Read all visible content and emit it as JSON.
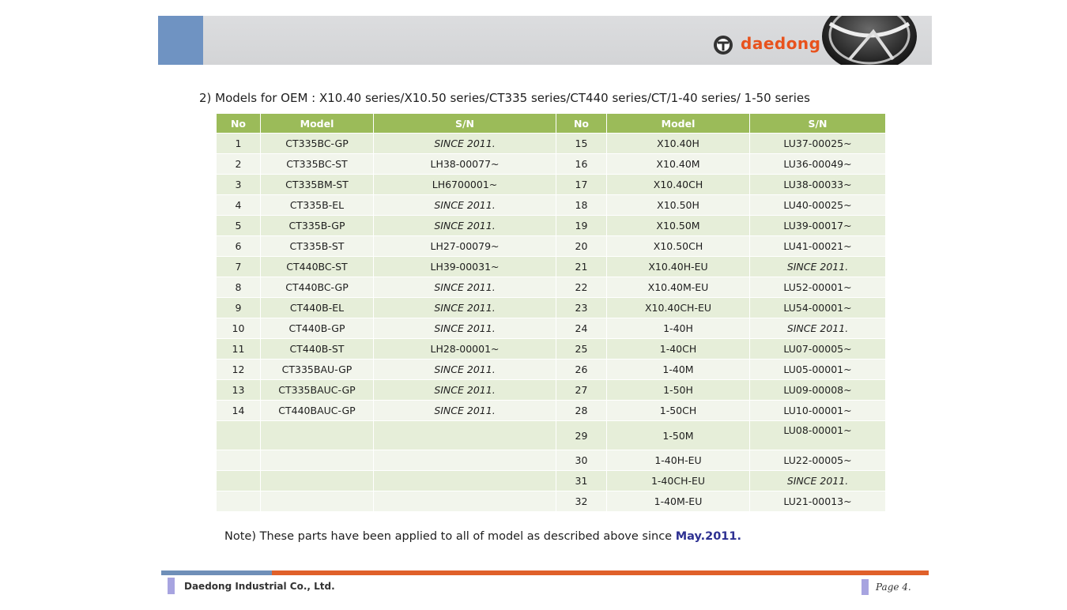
{
  "header": {
    "logo_text": "daedong",
    "colors": {
      "band": "#d6d7d9",
      "accent_blue": "#6f93c2",
      "brand_orange": "#e8521d"
    }
  },
  "heading": "2) Models for OEM : X10.40 series/X10.50 series/CT335 series/CT440 series/CT/1-40 series/ 1-50 series",
  "table": {
    "headers": [
      "No",
      "Model",
      "S/N",
      "No",
      "Model",
      "S/N"
    ],
    "header_color": "#9bbb59",
    "rows": [
      {
        "l_no": "1",
        "l_model": "CT335BC-GP",
        "l_sn": "SINCE 2011.",
        "r_no": "15",
        "r_model": "X10.40H",
        "r_sn": "LU37-00025~"
      },
      {
        "l_no": "2",
        "l_model": "CT335BC-ST",
        "l_sn": "LH38-00077~",
        "r_no": "16",
        "r_model": "X10.40M",
        "r_sn": "LU36-00049~"
      },
      {
        "l_no": "3",
        "l_model": "CT335BM-ST",
        "l_sn": "LH6700001~",
        "r_no": "17",
        "r_model": "X10.40CH",
        "r_sn": "LU38-00033~"
      },
      {
        "l_no": "4",
        "l_model": "CT335B-EL",
        "l_sn": "SINCE 2011.",
        "r_no": "18",
        "r_model": "X10.50H",
        "r_sn": "LU40-00025~"
      },
      {
        "l_no": "5",
        "l_model": "CT335B-GP",
        "l_sn": "SINCE 2011.",
        "r_no": "19",
        "r_model": "X10.50M",
        "r_sn": "LU39-00017~"
      },
      {
        "l_no": "6",
        "l_model": "CT335B-ST",
        "l_sn": "LH27-00079~",
        "r_no": "20",
        "r_model": "X10.50CH",
        "r_sn": "LU41-00021~"
      },
      {
        "l_no": "7",
        "l_model": "CT440BC-ST",
        "l_sn": "LH39-00031~",
        "r_no": "21",
        "r_model": "X10.40H-EU",
        "r_sn": "SINCE 2011."
      },
      {
        "l_no": "8",
        "l_model": "CT440BC-GP",
        "l_sn": "SINCE 2011.",
        "r_no": "22",
        "r_model": "X10.40M-EU",
        "r_sn": "LU52-00001~"
      },
      {
        "l_no": "9",
        "l_model": "CT440B-EL",
        "l_sn": "SINCE 2011.",
        "r_no": "23",
        "r_model": "X10.40CH-EU",
        "r_sn": "LU54-00001~"
      },
      {
        "l_no": "10",
        "l_model": "CT440B-GP",
        "l_sn": "SINCE 2011.",
        "r_no": "24",
        "r_model": "1-40H",
        "r_sn": "SINCE 2011."
      },
      {
        "l_no": "11",
        "l_model": "CT440B-ST",
        "l_sn": "LH28-00001~",
        "r_no": "25",
        "r_model": "1-40CH",
        "r_sn": "LU07-00005~"
      },
      {
        "l_no": "12",
        "l_model": "CT335BAU-GP",
        "l_sn": "SINCE 2011.",
        "r_no": "26",
        "r_model": "1-40M",
        "r_sn": "LU05-00001~"
      },
      {
        "l_no": "13",
        "l_model": "CT335BAUC-GP",
        "l_sn": "SINCE 2011.",
        "r_no": "27",
        "r_model": "1-50H",
        "r_sn": "LU09-00008~"
      },
      {
        "l_no": "14",
        "l_model": "CT440BAUC-GP",
        "l_sn": "SINCE 2011.",
        "r_no": "28",
        "r_model": "1-50CH",
        "r_sn": "LU10-00001~"
      },
      {
        "l_no": "",
        "l_model": "",
        "l_sn": "",
        "r_no": "29",
        "r_model": "1-50M",
        "r_sn": "LU08-00001~"
      },
      {
        "l_no": "",
        "l_model": "",
        "l_sn": "",
        "r_no": "30",
        "r_model": "1-40H-EU",
        "r_sn": "LU22-00005~"
      },
      {
        "l_no": "",
        "l_model": "",
        "l_sn": "",
        "r_no": "31",
        "r_model": "1-40CH-EU",
        "r_sn": "SINCE 2011."
      },
      {
        "l_no": "",
        "l_model": "",
        "l_sn": "",
        "r_no": "32",
        "r_model": "1-40M-EU",
        "r_sn": "LU21-00013~"
      }
    ]
  },
  "note": {
    "prefix": "Note) These parts have been applied to all of model as described above since ",
    "highlight": "May.2011.",
    "highlight_color": "#2e3192"
  },
  "footer": {
    "company": "Daedong Industrial Co., Ltd.",
    "page": "Page 4."
  }
}
